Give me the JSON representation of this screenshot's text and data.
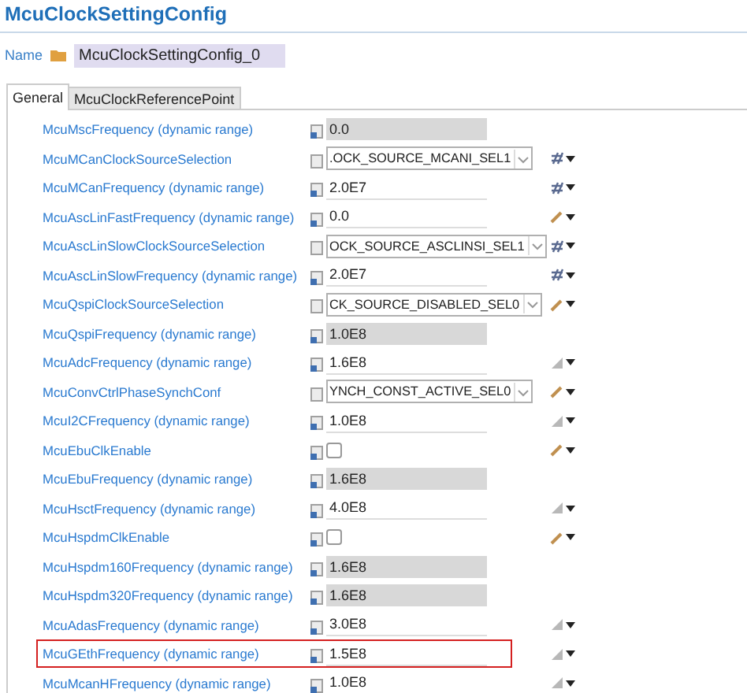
{
  "title": "McuClockSettingConfig",
  "name_field": {
    "label": "Name",
    "value": "McuClockSettingConfig_0"
  },
  "tabs": [
    {
      "label": "General",
      "selected": true
    },
    {
      "label": "McuClockReferencePoint",
      "selected": false
    }
  ],
  "rows": [
    {
      "label": "McuMscFrequency (dynamic range)",
      "kind": "readonly",
      "value": "0.0",
      "highlighted": false
    },
    {
      "label": "McuMCanClockSourceSelection",
      "kind": "select",
      "value": ".OCK_SOURCE_MCANI_SEL1",
      "adornment": {
        "kind": "link"
      },
      "highlighted": false
    },
    {
      "label": "McuMCanFrequency (dynamic range)",
      "kind": "text",
      "value": "2.0E7",
      "adornment": {
        "kind": "link"
      },
      "highlighted": false
    },
    {
      "label": "McuAscLinFastFrequency (dynamic range)",
      "kind": "text",
      "value": "0.0",
      "adornment": {
        "kind": "pencil"
      },
      "highlighted": false
    },
    {
      "label": "McuAscLinSlowClockSourceSelection",
      "kind": "select",
      "value": "OCK_SOURCE_ASCLINSI_SEL1",
      "adornment": {
        "kind": "link"
      },
      "highlighted": false
    },
    {
      "label": "McuAscLinSlowFrequency (dynamic range)",
      "kind": "text",
      "value": "2.0E7",
      "adornment": {
        "kind": "link"
      },
      "highlighted": false
    },
    {
      "label": "McuQspiClockSourceSelection",
      "kind": "select",
      "value": "CK_SOURCE_DISABLED_SEL0",
      "adornment": {
        "kind": "pencil"
      },
      "highlighted": false
    },
    {
      "label": "McuQspiFrequency (dynamic range)",
      "kind": "readonly",
      "value": "1.0E8",
      "highlighted": false
    },
    {
      "label": "McuAdcFrequency (dynamic range)",
      "kind": "text",
      "value": "1.6E8",
      "adornment": {
        "kind": "ramp"
      },
      "highlighted": false
    },
    {
      "label": "McuConvCtrlPhaseSynchConf",
      "kind": "select",
      "value": "YNCH_CONST_ACTIVE_SEL0",
      "adornment": {
        "kind": "pencil"
      },
      "highlighted": false
    },
    {
      "label": "McuI2CFrequency (dynamic range)",
      "kind": "text",
      "value": "1.0E8",
      "adornment": {
        "kind": "ramp"
      },
      "highlighted": false
    },
    {
      "label": "McuEbuClkEnable",
      "kind": "checkbox",
      "checked": false,
      "adornment": {
        "kind": "pencil"
      },
      "highlighted": false
    },
    {
      "label": "McuEbuFrequency (dynamic range)",
      "kind": "readonly",
      "value": "1.6E8",
      "highlighted": false
    },
    {
      "label": "McuHsctFrequency (dynamic range)",
      "kind": "text",
      "value": "4.0E8",
      "adornment": {
        "kind": "ramp"
      },
      "highlighted": false
    },
    {
      "label": "McuHspdmClkEnable",
      "kind": "checkbox",
      "checked": false,
      "adornment": {
        "kind": "pencil"
      },
      "highlighted": false
    },
    {
      "label": "McuHspdm160Frequency (dynamic range)",
      "kind": "readonly",
      "value": "1.6E8",
      "highlighted": false
    },
    {
      "label": "McuHspdm320Frequency (dynamic range)",
      "kind": "readonly",
      "value": "1.6E8",
      "highlighted": false
    },
    {
      "label": "McuAdasFrequency (dynamic range)",
      "kind": "text",
      "value": "3.0E8",
      "adornment": {
        "kind": "ramp"
      },
      "highlighted": false
    },
    {
      "label": "McuGEthFrequency (dynamic range)",
      "kind": "text",
      "value": "1.5E8",
      "adornment": {
        "kind": "ramp"
      },
      "highlighted": true
    },
    {
      "label": "McuMcanHFrequency (dynamic range)",
      "kind": "text",
      "value": "1.0E8",
      "adornment": {
        "kind": "ramp"
      },
      "highlighted": false
    }
  ]
}
